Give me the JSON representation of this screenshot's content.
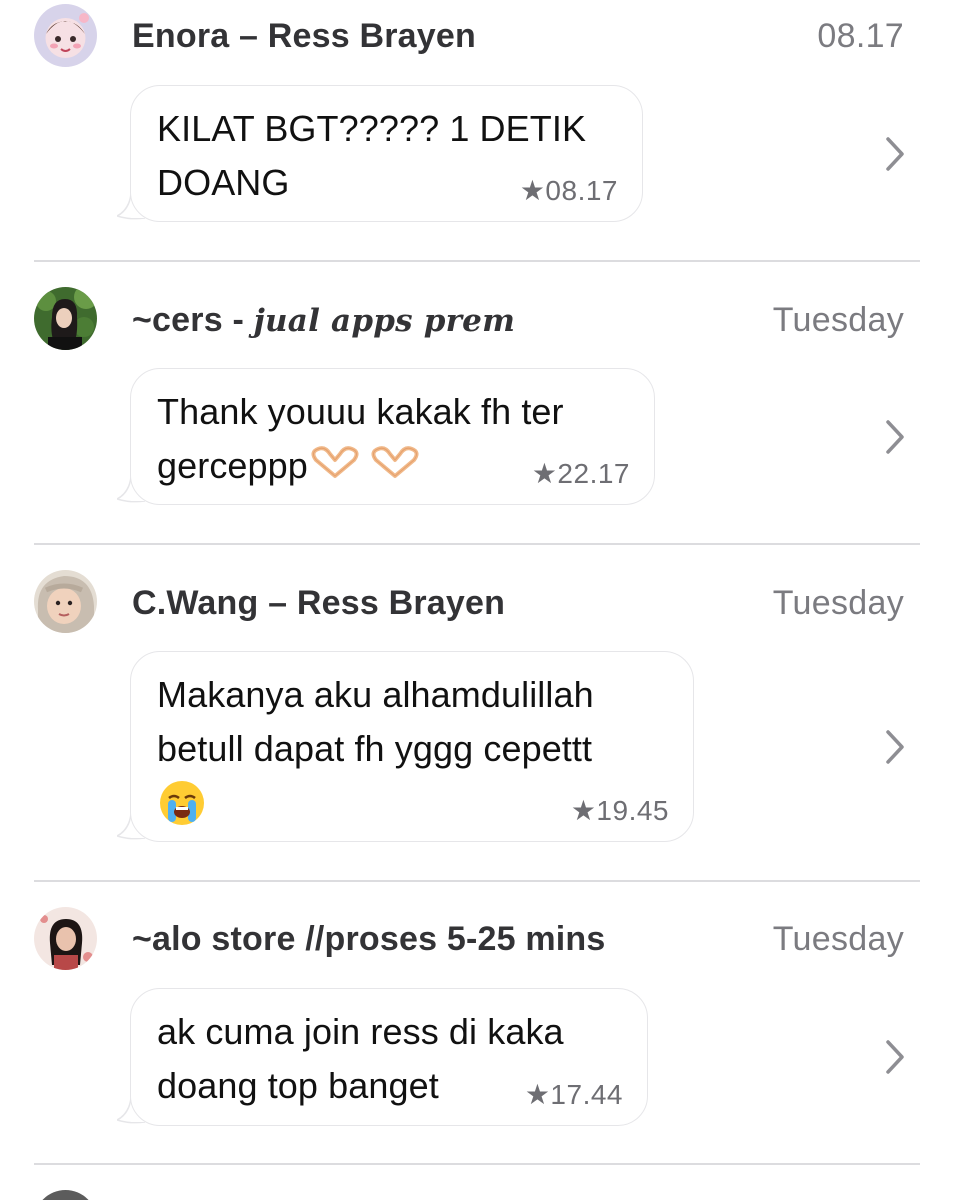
{
  "chats": [
    {
      "sender": "Enora – Ress Brayen",
      "sender_tag": "",
      "time": "08.17",
      "message": "KILAT BGT????? 1 DETIK\nDOANG",
      "stamp": "★08.17"
    },
    {
      "sender": "~cers - ",
      "sender_tag": "jual apps prem",
      "time": "Tuesday",
      "message": "Thank youuu kakak fh ter\ngerceppp",
      "stamp": "★22.17"
    },
    {
      "sender": "C.Wang – Ress Brayen",
      "sender_tag": "",
      "time": "Tuesday",
      "message": "Makanya aku alhamdulillah\nbetull dapat fh yggg cepettt",
      "stamp": "★19.45"
    },
    {
      "sender": "~alo store //proses 5-25 mins",
      "sender_tag": "",
      "time": "Tuesday",
      "message": "ak cuma join ress di kaka\ndoang top banget",
      "stamp": "★17.44"
    }
  ],
  "icons": {
    "chevron": "chevron-right-icon",
    "heart_hands": "heart-hands-emoji",
    "crying_face": "loudly-crying-face-emoji"
  },
  "colors": {
    "sender_text": "#333336",
    "time_text": "#7b7b80",
    "bubble_border": "#e6e6e9",
    "divider": "#dcdcdf"
  }
}
